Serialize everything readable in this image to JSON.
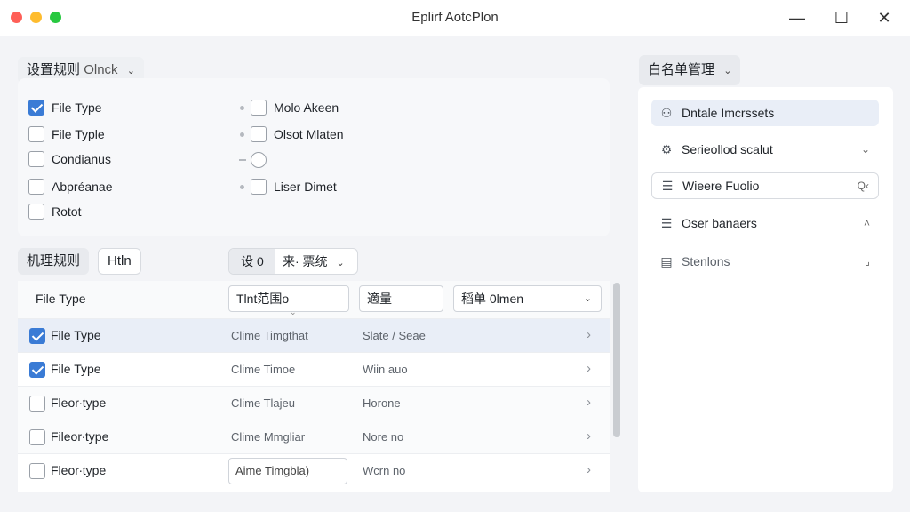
{
  "window": {
    "title": "Eplirf AotcPlon"
  },
  "rule_settings": {
    "dropdown_label": "设置规则",
    "dropdown_value": "Olnck",
    "options_left": [
      {
        "label": "File Type",
        "checked": true
      },
      {
        "label": "File Typle",
        "checked": false
      },
      {
        "label": "Condianus",
        "checked": false
      },
      {
        "label": "Abpréanae",
        "checked": false
      },
      {
        "label": "Rotot",
        "checked": false
      }
    ],
    "options_right": [
      {
        "label": "Molo Akeen",
        "checked": false
      },
      {
        "label": "Olsot Mlaten",
        "checked": false
      },
      {
        "label": "",
        "checked": false
      },
      {
        "label": "Liser Dimet",
        "checked": false
      }
    ]
  },
  "rule_tabs": {
    "active": "机理规则",
    "other": "Htln",
    "segment_a": "设 0",
    "segment_b": "来· 票统"
  },
  "table": {
    "header_label": "File Type",
    "filter_1": "Tlnt范围o",
    "filter_2": "適量",
    "filter_3": "稻单 0lmen",
    "rows": [
      {
        "name": "File Type",
        "time": "Clime Timgthat",
        "state": "Slate / Seae",
        "checked": true
      },
      {
        "name": "File Type",
        "time": "Clime Timoe",
        "state": "Wiin auo",
        "checked": true
      },
      {
        "name": "Fleor∙type",
        "time": "Clime Tlajeu",
        "state": "Horone",
        "checked": false
      },
      {
        "name": "Fileor∙type",
        "time": "Clime Mmgliar",
        "state": "Nore no",
        "checked": false
      },
      {
        "name": "Fleor∙type",
        "time": "Aime Timgbla)",
        "state": "Wcrn no",
        "checked": false
      }
    ]
  },
  "whitelist": {
    "dropdown_label": "白名单管理",
    "items": [
      {
        "icon": "user-icon",
        "label": "Dntale Imcrssets",
        "trail": ""
      },
      {
        "icon": "key-icon",
        "label": "Serieollod scalut",
        "trail": "⌄"
      },
      {
        "icon": "list-icon",
        "label": "Wieere Fuolio",
        "trail": "Q‹"
      },
      {
        "icon": "list-icon",
        "label": "Oser banaers",
        "trail": "˄"
      },
      {
        "icon": "document-icon",
        "label": "Stenlons",
        "trail": "⌟"
      }
    ]
  }
}
